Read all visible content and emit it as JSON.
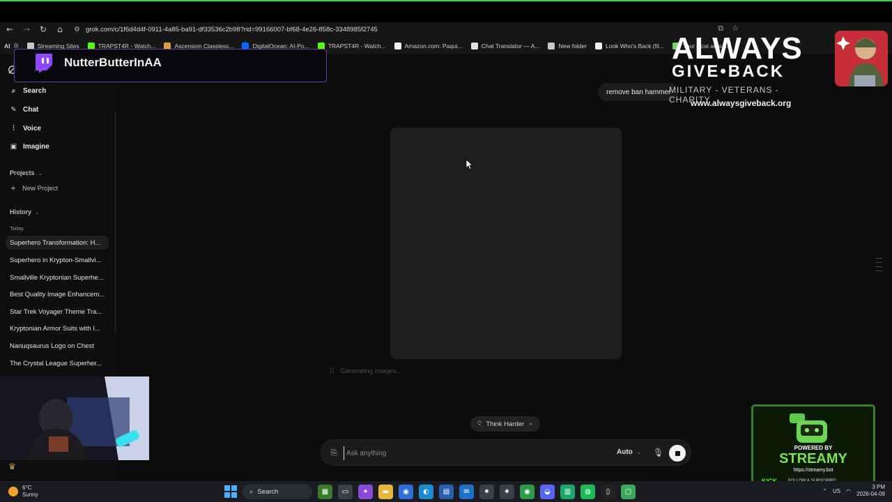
{
  "browser": {
    "url": "grok.com/c/1f6d4d4f-0911-4a85-ba91-df33536c2b98?rid=99166007-bf68-4e26-858c-3348985f2745",
    "apps_label": "AI",
    "bookmarks": [
      {
        "label": "Streaming Sites",
        "icon": "folder-icon",
        "color": "#c8c8c8"
      },
      {
        "label": "TRAPST4R - Watch...",
        "icon": "kick-icon",
        "color": "#53fc18"
      },
      {
        "label": "Ascension Classless...",
        "icon": "ascension-icon",
        "color": "#d9a13a"
      },
      {
        "label": "DigitalOcean: AI-Po...",
        "icon": "digitalocean-icon",
        "color": "#0069ff"
      },
      {
        "label": "TRAPST4R - Watch...",
        "icon": "kick-icon",
        "color": "#53fc18"
      },
      {
        "label": "Amazon.com: Paqui...",
        "icon": "amazon-icon",
        "color": "#f2f2f2"
      },
      {
        "label": "Chat Translator — A...",
        "icon": "translator-icon",
        "color": "#e0e0e0"
      },
      {
        "label": "New folder",
        "icon": "folder-icon",
        "color": "#c8c8c8"
      },
      {
        "label": "Look Who's Back (fil...",
        "icon": "wikipedia-icon",
        "color": "#f2f2f2"
      },
      {
        "label": "Your local auto 4...",
        "icon": "map-pin-icon",
        "color": "#7bd36b"
      }
    ]
  },
  "twitch": {
    "username": "NutterButterInAA"
  },
  "sidebar": {
    "nav": [
      {
        "label": "Search",
        "icon": "search-icon",
        "glyph": "⌕"
      },
      {
        "label": "Chat",
        "icon": "chat-icon",
        "glyph": "✎"
      },
      {
        "label": "Voice",
        "icon": "voice-icon",
        "glyph": "⫶"
      },
      {
        "label": "Imagine",
        "icon": "imagine-icon",
        "glyph": "▣"
      }
    ],
    "projects_label": "Projects",
    "new_project_label": "New Project",
    "history_label": "History",
    "today_label": "Today",
    "history": [
      "Superhero Transformation: H...",
      "Superhero in Krypton-Smallvi...",
      "Smallville Kryptonian Superhe...",
      "Best Quality Image Enhancem...",
      "Star Trek Voyager Theme Tra...",
      "Kryptonian Armor Suits with I...",
      "Nanuqsaurus Logo on Chest",
      "The Crystal League Superher..."
    ]
  },
  "chat": {
    "user_message": "remove ban hammer",
    "status": "Generating images...",
    "think_harder_label": "Think Harder",
    "input_placeholder": "Ask anything",
    "model_label": "Auto"
  },
  "brand": {
    "line1": "ALWAYS",
    "line2": "GIVE•BACK",
    "tagline": "MILITARY - VETERANS - CHARITY",
    "url": "www.alwaysgiveback.org"
  },
  "streamy": {
    "powered_by": "POWERED BY",
    "name": "STREAMY",
    "url": "https://streamy.bot",
    "kick": "KICK",
    "follow": "FOLLOW & SUBSCRIBE!"
  },
  "taskbar": {
    "temperature": "6°C",
    "condition": "Sunny",
    "search_label": "Search",
    "language": "US",
    "time": "3 PM",
    "date": "2026-04-09"
  },
  "colors": {
    "accent_twitch": "#6441a5",
    "streamy_green": "#3a7d2b",
    "kick_green": "#53fc18"
  }
}
